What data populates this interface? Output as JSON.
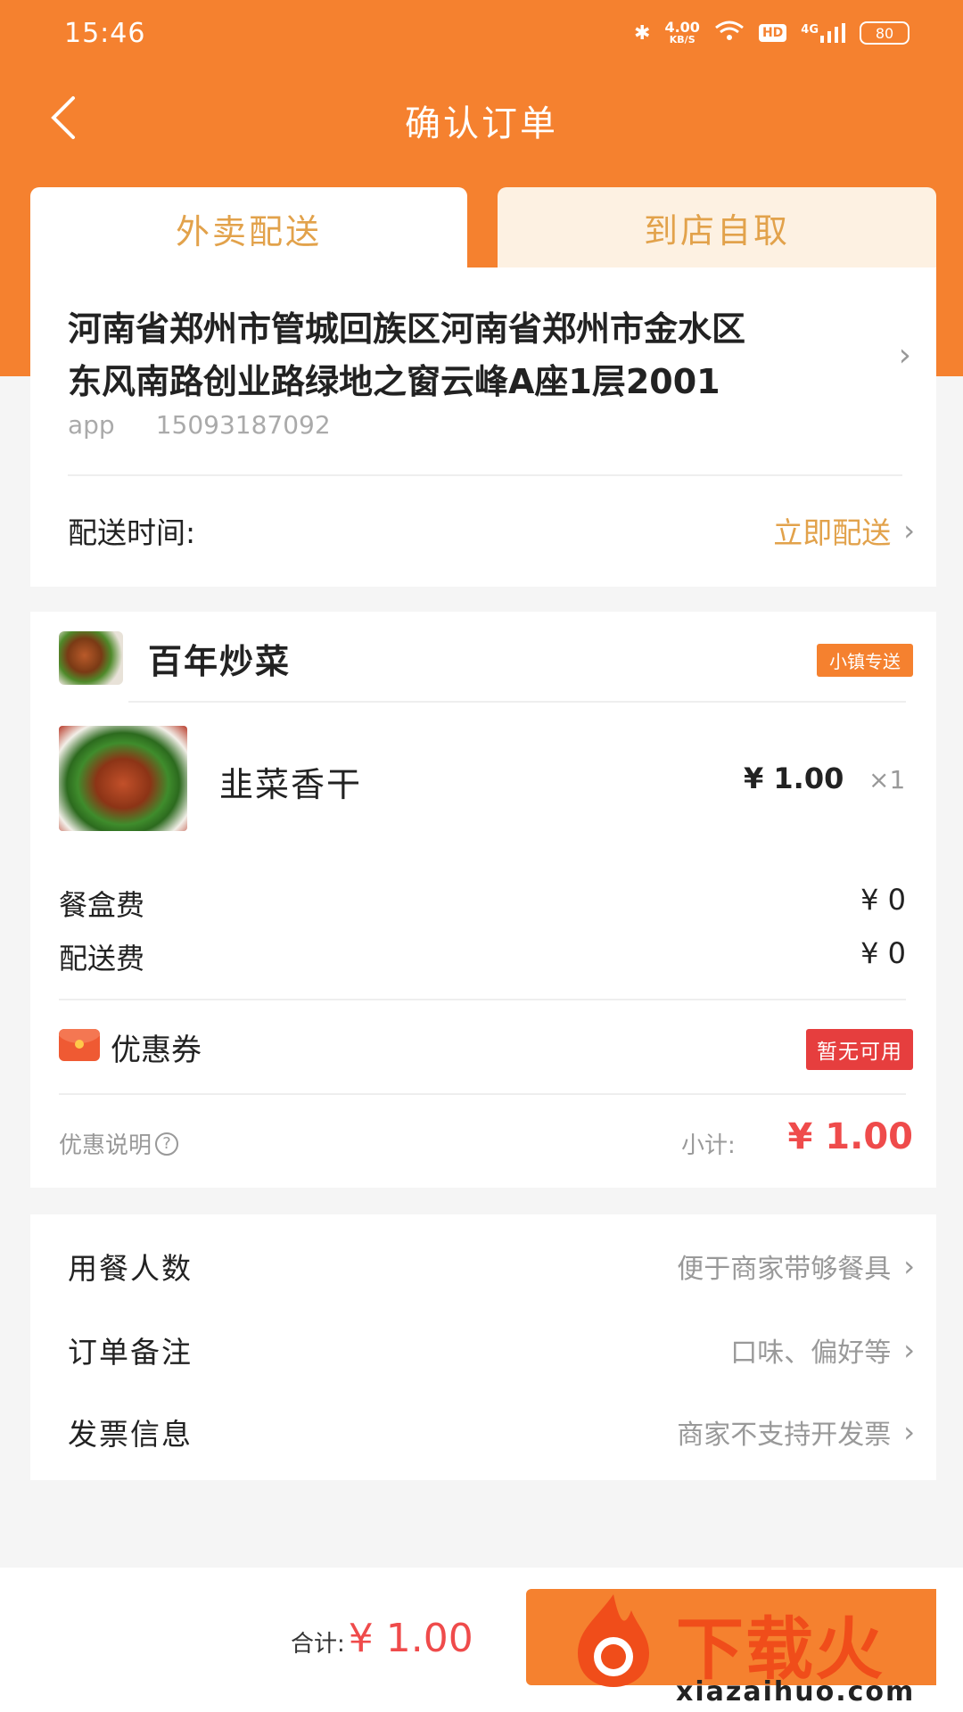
{
  "status_bar": {
    "time": "15:46",
    "net_speed_value": "4.00",
    "net_speed_unit": "KB/S",
    "hd": "HD",
    "signal": "4G",
    "battery": "80"
  },
  "navbar": {
    "title": "确认订单",
    "back_icon": "chevron-left-icon"
  },
  "tabs": [
    {
      "label": "外卖配送",
      "active": true
    },
    {
      "label": "到店自取",
      "active": false
    }
  ],
  "address": {
    "line1": "河南省郑州市管城回族区河南省郑州市金水区",
    "line2": "东风南路创业路绿地之窗云峰A座1层2001",
    "name": "app",
    "phone": "15093187092"
  },
  "delivery": {
    "label": "配送时间:",
    "value": "立即配送"
  },
  "shop": {
    "name": "百年炒菜",
    "badge": "小镇专送",
    "items": [
      {
        "name": "韭菜香干",
        "price": "¥ 1.00",
        "qty": "×1"
      }
    ],
    "fees": [
      {
        "label": "餐盒费",
        "value": "¥ 0"
      },
      {
        "label": "配送费",
        "value": "¥ 0"
      }
    ],
    "coupon": {
      "label": "优惠券",
      "badge": "暂无可用"
    },
    "promo_info": "优惠说明",
    "subtotal_label": "小计:",
    "subtotal_value": "¥ 1.00"
  },
  "extras": [
    {
      "label": "用餐人数",
      "value": "便于商家带够餐具"
    },
    {
      "label": "订单备注",
      "value": "口味、偏好等"
    },
    {
      "label": "发票信息",
      "value": "商家不支持开发票"
    }
  ],
  "bottom": {
    "total_label": "合计:",
    "total_value": "¥ 1.00"
  },
  "watermark": {
    "text": "下载火",
    "url": "xiazaihuo.com"
  },
  "colors": {
    "brand": "#f5812f",
    "accent_text": "#e2a24b",
    "price_red": "#ef4b4b"
  }
}
